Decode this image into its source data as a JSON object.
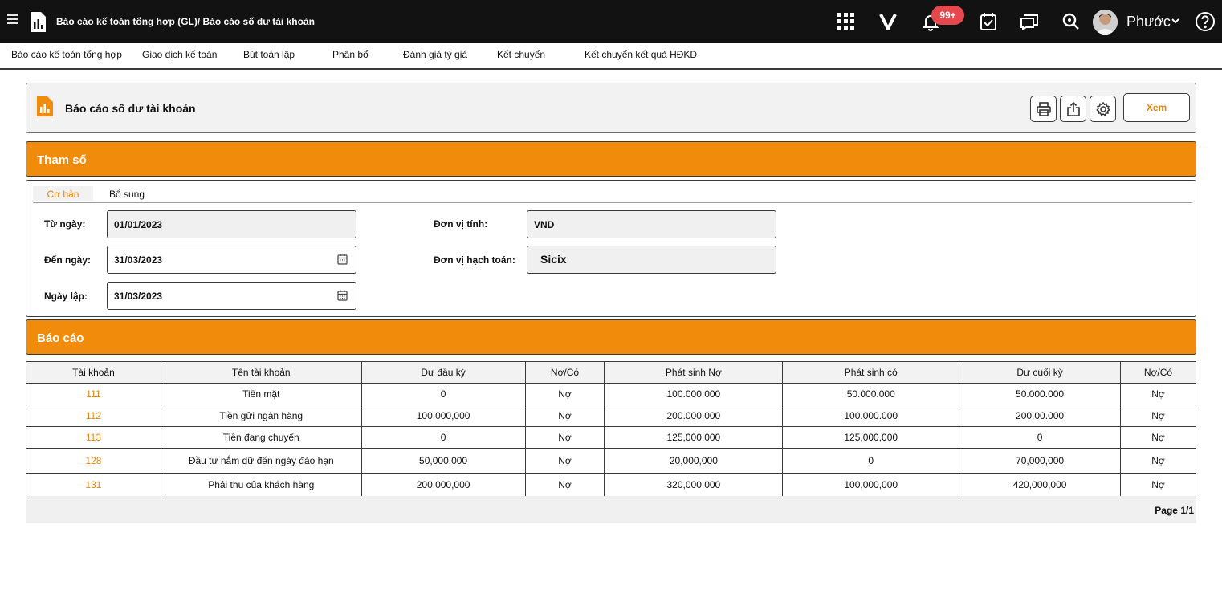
{
  "app": {
    "breadcrumb": "Báo cáo kế toán tổng hợp (GL)/ Báo cáo số dư tài khoản",
    "notification_count": "99+",
    "user_name": "Phước",
    "brand_color": "#f08b0c",
    "accent_text_color": "#e8850f",
    "icons": [
      "menu-icon",
      "app-logo-icon",
      "apps-grid-icon",
      "v-logo-icon",
      "bell-icon",
      "task-check-icon",
      "chat-icon",
      "search-icon",
      "chevron-down-icon",
      "help-icon"
    ]
  },
  "menu": [
    "Báo cáo kế toán tổng hợp",
    "Giao dịch kế toán",
    "Bút toán lập",
    "Phân bổ",
    "Đánh giá tỷ giá",
    "Kết chuyển",
    "Kết chuyển kết quả HĐKD"
  ],
  "header": {
    "title": "Báo cáo số dư tài khoản",
    "view_label": "Xem",
    "icons": [
      "print-icon",
      "export-icon",
      "settings-icon"
    ]
  },
  "params": {
    "title": "Tham số",
    "tabs": [
      "Cơ bản",
      "Bổ sung"
    ],
    "from_date_label": "Từ ngày:",
    "from_date": "01/01/2023",
    "to_date_label": "Đến ngày:",
    "to_date": "31/03/2023",
    "created_date_label": "Ngày lập:",
    "created_date": "31/03/2023",
    "unit_label": "Đơn vị tính:",
    "unit": "VND",
    "entity_label": "Đơn vị hạch toán:",
    "entity": "Sicix"
  },
  "report": {
    "title": "Báo cáo",
    "columns": [
      "Tài khoản",
      "Tên tài khoản",
      "Dư đầu kỳ",
      "Nợ/Có",
      "Phát sinh Nợ",
      "Phát sinh có",
      "Dư cuối kỳ",
      "Nợ/Có"
    ],
    "rows": [
      [
        "111",
        "Tiền mặt",
        "0",
        "Nợ",
        "100.000.000",
        "50.000.000",
        "50.000.000",
        "Nợ"
      ],
      [
        "112",
        "Tiền gửi ngân hàng",
        "100,000,000",
        "Nợ",
        "200.000.000",
        "100.000.000",
        "200.00.000",
        "Nợ"
      ],
      [
        "113",
        "Tiền đang chuyển",
        "0",
        "Nợ",
        "125,000,000",
        "125,000,000",
        "0",
        "Nợ"
      ],
      [
        "128",
        "Đầu tư nắm dữ đến ngày đáo hạn",
        "50,000,000",
        "Nợ",
        "20,000,000",
        "0",
        "70,000,000",
        "Nợ"
      ],
      [
        "131",
        "Phải thu của khách hàng",
        "200,000,000",
        "Nợ",
        "320,000,000",
        "100,000,000",
        "420,000,000",
        "Nợ"
      ]
    ],
    "page_info": "Page 1/1"
  }
}
